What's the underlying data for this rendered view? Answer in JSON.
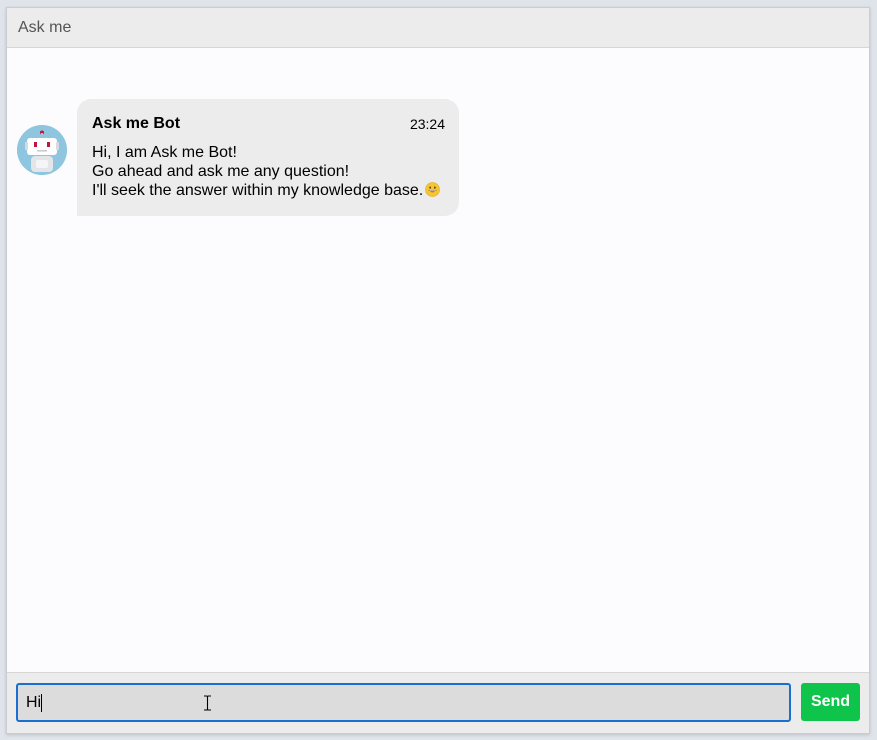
{
  "header": {
    "title": "Ask me"
  },
  "messages": [
    {
      "sender": "Ask me Bot",
      "time": "23:24",
      "lines": [
        "Hi, I am Ask me Bot!",
        "Go ahead and ask me any question!",
        "I'll seek the answer within my knowledge base."
      ],
      "emoji": "grinning-face-emoji",
      "avatar_icon": "robot-icon"
    }
  ],
  "composer": {
    "value": "Hi",
    "send_label": "Send"
  },
  "colors": {
    "send_button": "#0fc44a",
    "input_focus_border": "#1a6fd1",
    "avatar_bg": "#8ec6e0",
    "bubble_bg": "#ececec"
  }
}
